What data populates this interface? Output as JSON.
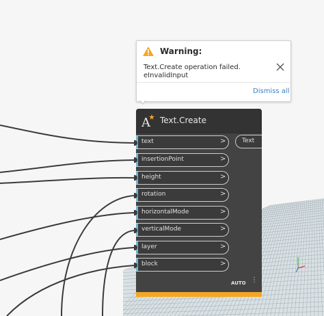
{
  "warning": {
    "title": "Warning:",
    "message_line1": "Text.Create operation failed.",
    "message_line2": "eInvalidInput",
    "dismiss_label": "Dismiss all"
  },
  "node": {
    "title": "Text.Create",
    "inputs": [
      {
        "label": "text",
        "chevron": ">"
      },
      {
        "label": "insertionPoint",
        "chevron": ">"
      },
      {
        "label": "height",
        "chevron": ">"
      },
      {
        "label": "rotation",
        "chevron": ">"
      },
      {
        "label": "horizontalMode",
        "chevron": ">"
      },
      {
        "label": "verticalMode",
        "chevron": ">"
      },
      {
        "label": "layer",
        "chevron": ">"
      },
      {
        "label": "block",
        "chevron": ">"
      }
    ],
    "output": "Text",
    "lacing": "AUTO",
    "more": "⋮"
  },
  "colors": {
    "accent_bar": "#6fb6d8",
    "footer": "#f5a623",
    "warning_icon": "#f5a623",
    "link": "#3a7fc1"
  },
  "icons": {
    "warning": "warning-triangle-icon",
    "close": "close-icon",
    "node": "text-create-icon",
    "axis": "axis-gizmo-icon"
  }
}
